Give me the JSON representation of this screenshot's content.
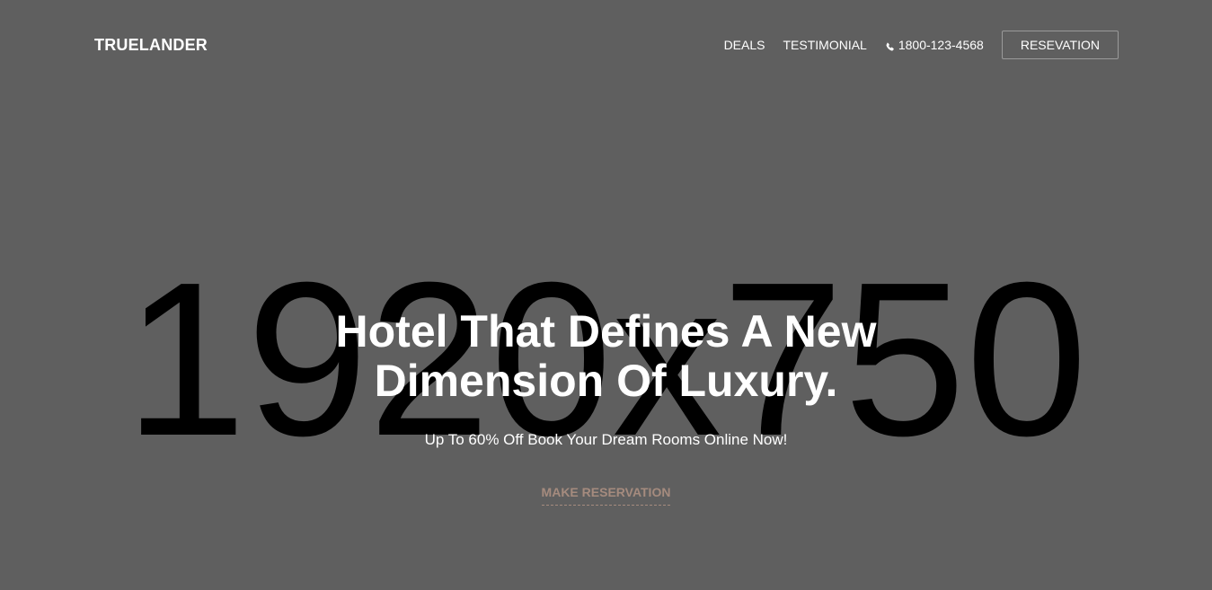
{
  "placeholder": {
    "text": "1920x750"
  },
  "navbar": {
    "brand": "TRUELANDER",
    "links": [
      {
        "label": "DEALS"
      },
      {
        "label": "TESTIMONIAL"
      }
    ],
    "phone": {
      "icon": "phone-icon",
      "number": "1800-123-4568"
    },
    "reservation_button": "RESEVATION"
  },
  "hero": {
    "headline_line1": "Hotel That Defines A New",
    "headline_line2": "Dimension Of Luxury.",
    "subtitle": "Up To 60% Off Book Your Dream Rooms Online Now!",
    "cta": "MAKE RESERVATION"
  },
  "colors": {
    "background": "#5f5f5f",
    "accent": "#a58b7e",
    "text": "#ffffff"
  }
}
